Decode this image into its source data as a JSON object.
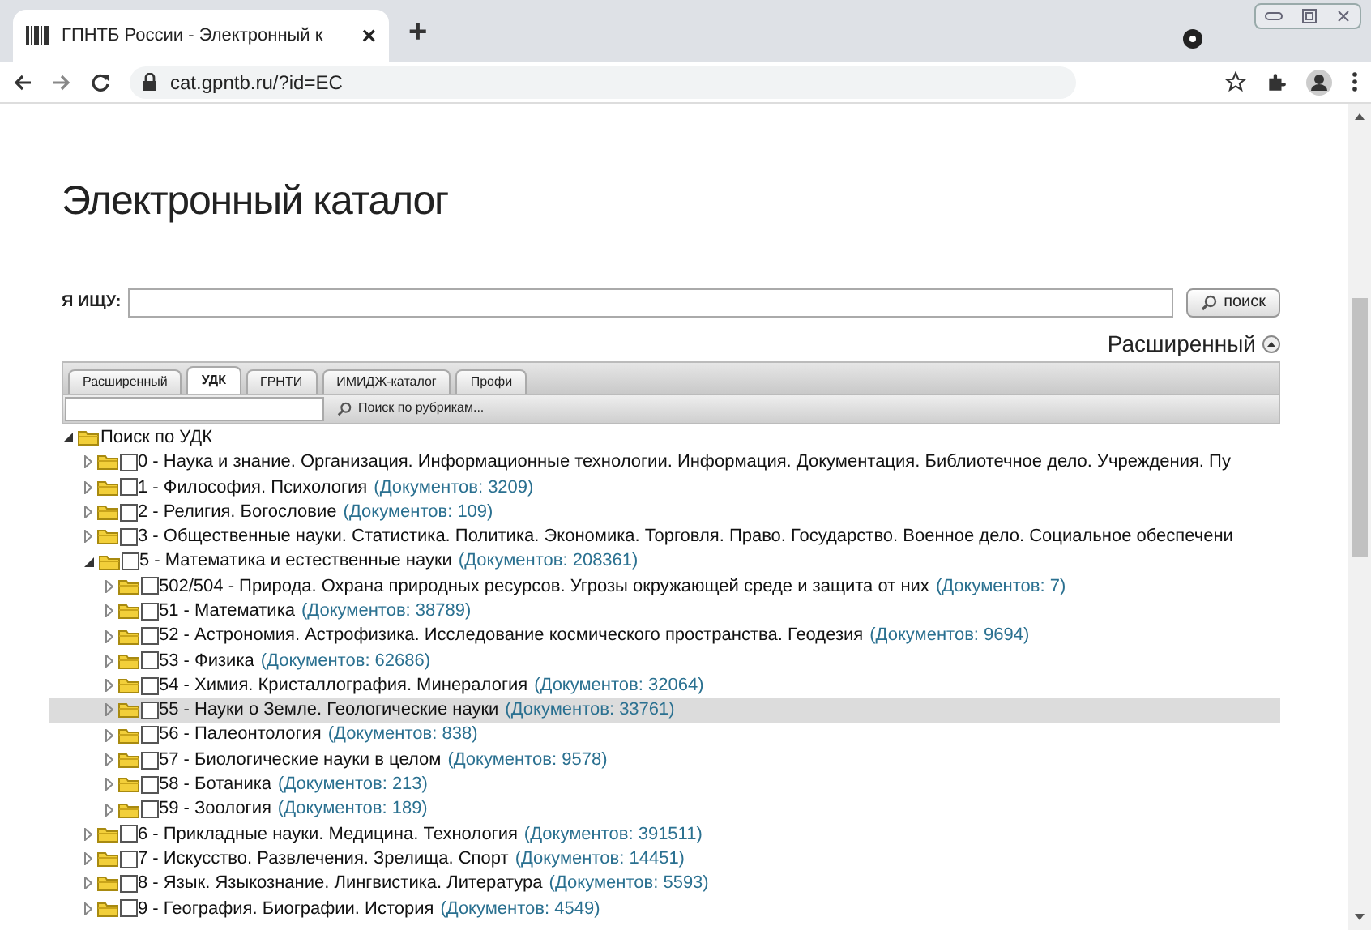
{
  "browser": {
    "tab_title": "ГПНТБ России - Электронный к",
    "tab_close": "×",
    "new_tab": "+",
    "url": "cat.gpntb.ru/?id=EC"
  },
  "page": {
    "heading": "Электронный каталог",
    "search_label": "Я ИЩУ:",
    "search_button": "поиск",
    "advanced_toggle": "Расширенный",
    "advanced_expanded": true
  },
  "tabs": [
    {
      "label": "Расширенный",
      "selected": false
    },
    {
      "label": "УДК",
      "selected": true
    },
    {
      "label": "ГРНТИ",
      "selected": false
    },
    {
      "label": "ИМИДЖ-каталог",
      "selected": false
    },
    {
      "label": "Профи",
      "selected": false
    }
  ],
  "rubric_search": {
    "button": "Поиск по рубрикам..."
  },
  "tree": [
    {
      "label": "Поиск по УДК",
      "expanded": true,
      "selected": false,
      "children": [
        {
          "label": "0 - Наука и знание. Организация. Информационные технологии. Информация. Документация. Библиотечное дело. Учреждения. Пу",
          "checked": false,
          "expanded": false,
          "selected": false
        },
        {
          "label": "1 - Философия. Психология",
          "count": "(Документов: 3209)",
          "checked": false,
          "expanded": false,
          "selected": false
        },
        {
          "label": "2 - Религия. Богословие",
          "count": "(Документов: 109)",
          "checked": false,
          "expanded": false,
          "selected": false
        },
        {
          "label": "3 - Общественные науки. Статистика. Политика. Экономика. Торговля. Право. Государство. Военное дело. Социальное обеспечени",
          "checked": false,
          "expanded": false,
          "selected": false
        },
        {
          "label": "5 - Математика и естественные науки",
          "count": "(Документов: 208361)",
          "checked": false,
          "expanded": true,
          "selected": false,
          "children": [
            {
              "label": "502/504 - Природа. Охрана природных ресурсов. Угрозы окружающей среде и защита от них",
              "count": "(Документов: 7)",
              "checked": false,
              "expanded": false,
              "selected": false
            },
            {
              "label": "51 - Математика",
              "count": "(Документов: 38789)",
              "checked": false,
              "expanded": false,
              "selected": false
            },
            {
              "label": "52 - Астрономия. Астрофизика. Исследование космического пространства. Геодезия",
              "count": "(Документов: 9694)",
              "checked": false,
              "expanded": false,
              "selected": false
            },
            {
              "label": "53 - Физика",
              "count": "(Документов: 62686)",
              "checked": false,
              "expanded": false,
              "selected": false
            },
            {
              "label": "54 - Химия. Кристаллография. Минералогия",
              "count": "(Документов: 32064)",
              "checked": false,
              "expanded": false,
              "selected": false
            },
            {
              "label": "55 - Науки о Земле. Геологические науки",
              "count": "(Документов: 33761)",
              "checked": false,
              "expanded": false,
              "selected": true
            },
            {
              "label": "56 - Палеонтология",
              "count": "(Документов: 838)",
              "checked": false,
              "expanded": false,
              "selected": false
            },
            {
              "label": "57 - Биологические науки в целом",
              "count": "(Документов: 9578)",
              "checked": false,
              "expanded": false,
              "selected": false
            },
            {
              "label": "58 - Ботаника",
              "count": "(Документов: 213)",
              "checked": false,
              "expanded": false,
              "selected": false
            },
            {
              "label": "59 - Зоология",
              "count": "(Документов: 189)",
              "checked": false,
              "expanded": false,
              "selected": false
            }
          ]
        },
        {
          "label": "6 - Прикладные науки. Медицина. Технология",
          "count": "(Документов: 391511)",
          "checked": false,
          "expanded": false,
          "selected": false
        },
        {
          "label": "7 - Искусство. Развлечения. Зрелища. Спорт",
          "count": "(Документов: 14451)",
          "checked": false,
          "expanded": false,
          "selected": false
        },
        {
          "label": "8 - Язык. Языкознание. Лингвистика. Литература",
          "count": "(Документов: 5593)",
          "checked": false,
          "expanded": false,
          "selected": false
        },
        {
          "label": "9 - География. Биографии. История",
          "count": "(Документов: 4549)",
          "checked": false,
          "expanded": false,
          "selected": false
        }
      ]
    }
  ]
}
